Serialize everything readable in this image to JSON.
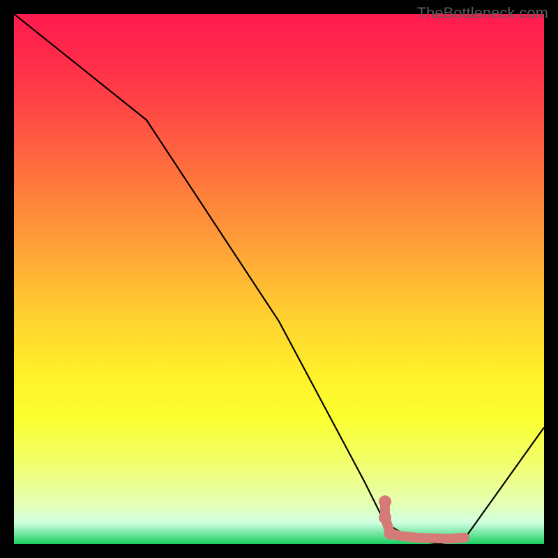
{
  "watermark": "TheBottleneck.com",
  "chart_data": {
    "type": "line",
    "title": "",
    "xlabel": "",
    "ylabel": "",
    "xlim": [
      0,
      100
    ],
    "ylim": [
      0,
      100
    ],
    "series": [
      {
        "name": "bottleneck-curve",
        "x": [
          0,
          25,
          50,
          66,
          70,
          75,
          80,
          85,
          100
        ],
        "y": [
          100,
          80,
          42,
          12,
          4,
          1,
          0,
          1,
          22
        ]
      }
    ],
    "marker_region": {
      "name": "optimal-zone",
      "color": "#d67a78",
      "points": [
        {
          "x": 70,
          "y": 8
        },
        {
          "x": 70,
          "y": 5
        },
        {
          "x": 71,
          "y": 2
        },
        {
          "x": 73,
          "y": 1.5
        },
        {
          "x": 76,
          "y": 1.2
        },
        {
          "x": 79,
          "y": 1.1
        },
        {
          "x": 82,
          "y": 1.0
        },
        {
          "x": 85,
          "y": 1.2
        }
      ]
    },
    "gradient_stops": [
      {
        "pos": 0,
        "color": "#ff1a4f"
      },
      {
        "pos": 50,
        "color": "#ffb035"
      },
      {
        "pos": 75,
        "color": "#fff02a"
      },
      {
        "pos": 100,
        "color": "#18d060"
      }
    ]
  }
}
